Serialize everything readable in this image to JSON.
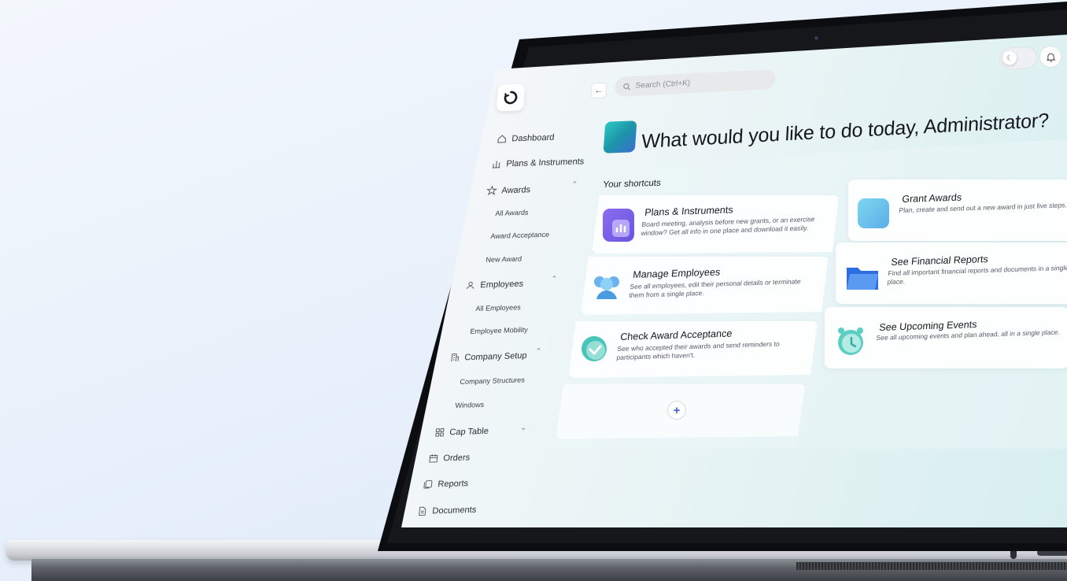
{
  "header": {
    "search_placeholder": "Search (Ctrl+K)",
    "back_label": "←",
    "greeting": "What would you like to do today, Administrator?"
  },
  "sidebar": {
    "dashboard": "Dashboard",
    "plans": "Plans & Instruments",
    "awards": "Awards",
    "awards_items": [
      "All Awards",
      "Award Acceptance",
      "New Award"
    ],
    "employees": "Employees",
    "employees_items": [
      "All Employees",
      "Employee Mobility"
    ],
    "company_setup": "Company Setup",
    "company_items": [
      "Company Structures",
      "Windows"
    ],
    "cap_table": "Cap Table",
    "orders": "Orders",
    "reports": "Reports",
    "documents": "Documents"
  },
  "shortcuts": {
    "label": "Your shortcuts",
    "add_label": "+",
    "cards": [
      {
        "title": "Plans & Instruments",
        "desc": "Board meeting, analysis before new grants, or an exercise window? Get all info in one place and download it easily."
      },
      {
        "title": "Grant Awards",
        "desc": "Plan, create and send out a new award in just five steps."
      },
      {
        "title": "Manage Employees",
        "desc": "See all employees, edit their personal details or terminate them from a single place."
      },
      {
        "title": "See Financial Reports",
        "desc": "Find all important financial reports and documents in a single place."
      },
      {
        "title": "Check Award Acceptance",
        "desc": "See who accepted their awards and send reminders to participants which haven't."
      },
      {
        "title": "See Upcoming Events",
        "desc": "See all upcoming events and plan ahead, all in a single place."
      }
    ]
  },
  "colors": {
    "accent": "#3d63d8",
    "teal": "#2ec8c6",
    "purple": "#8b5cf6"
  },
  "icons": [
    "logo-icon",
    "home-icon",
    "chart-icon",
    "awards-icon",
    "employees-icon",
    "building-icon",
    "grid-icon",
    "calendar-icon",
    "copy-icon",
    "document-icon",
    "search-icon",
    "moon-icon",
    "bell-icon"
  ]
}
